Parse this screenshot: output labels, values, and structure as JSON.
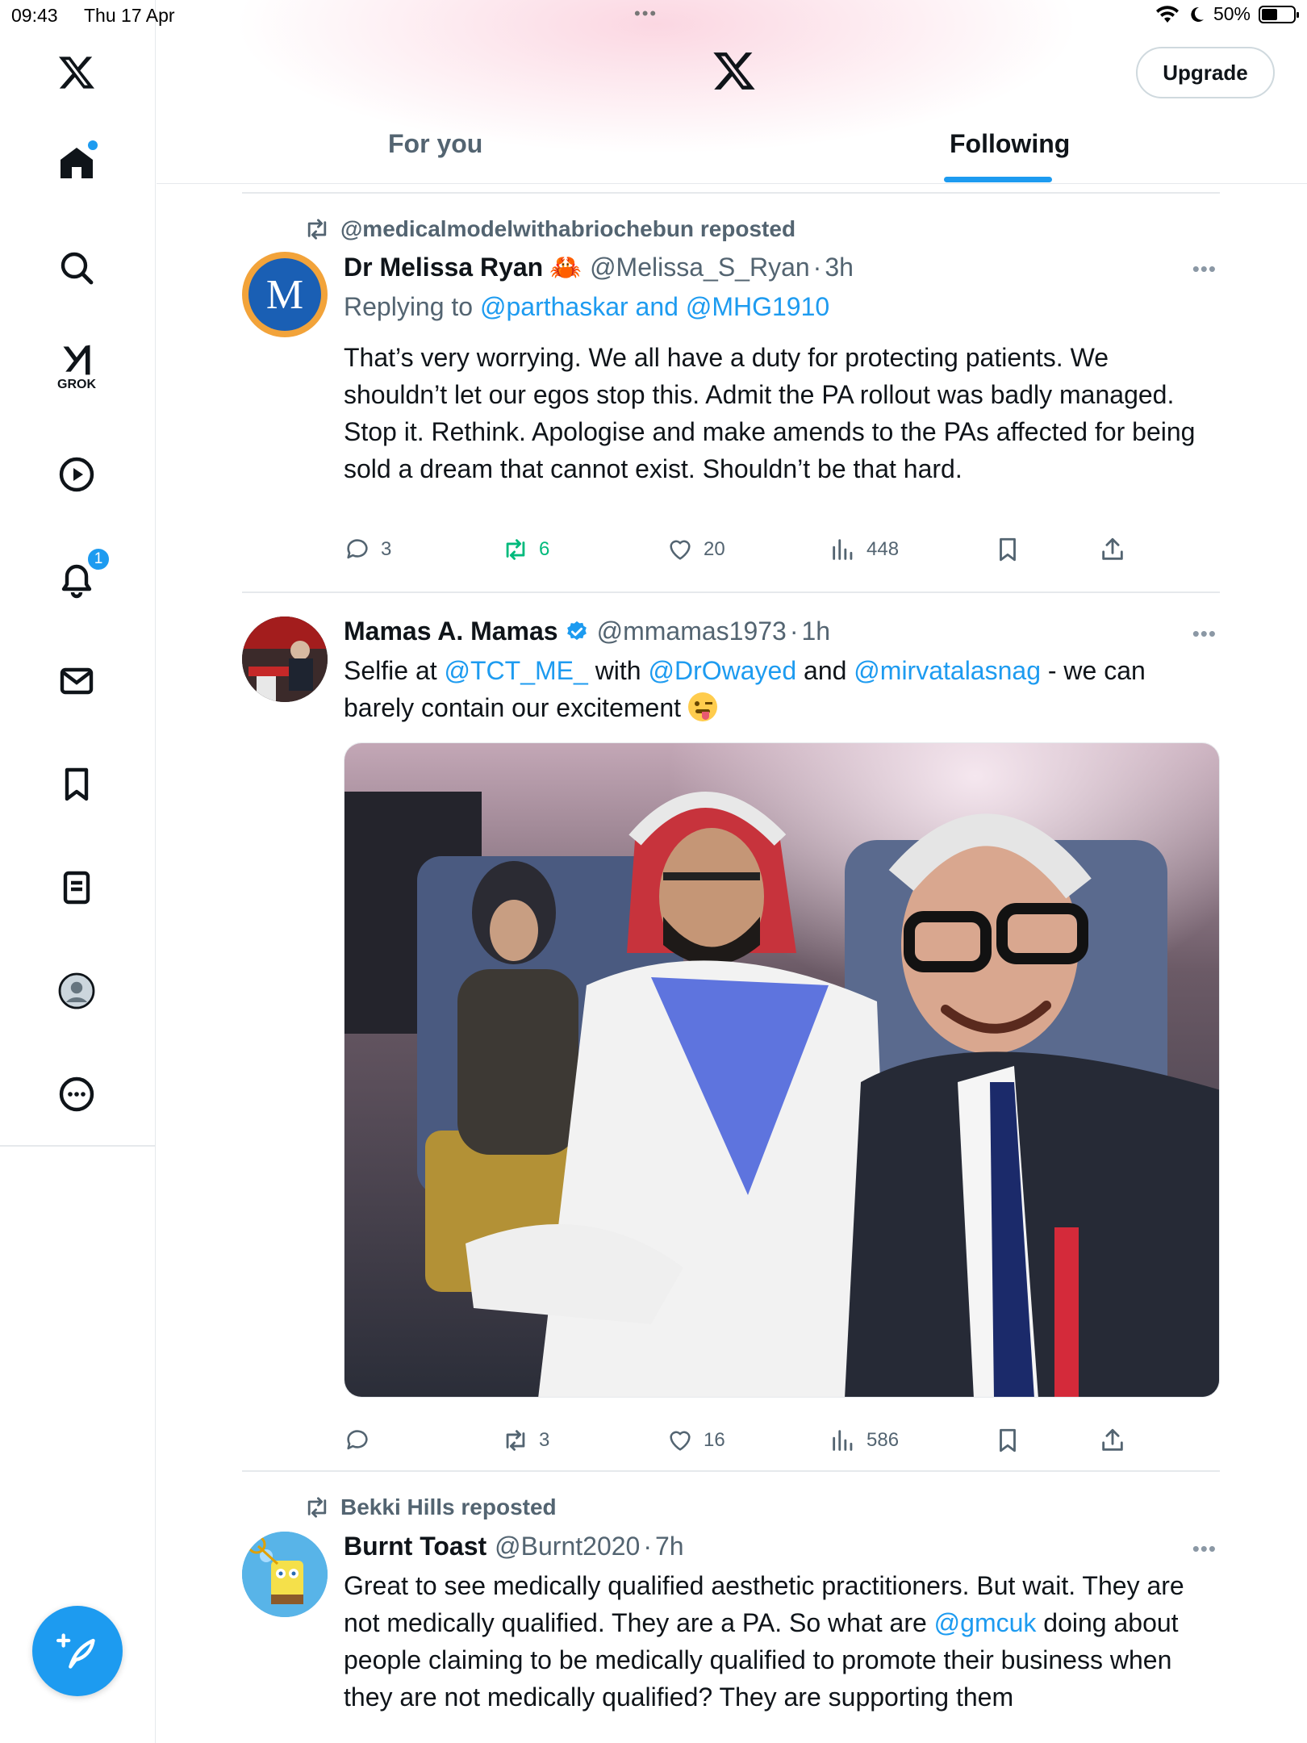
{
  "status_bar": {
    "time": "09:43",
    "date": "Thu 17 Apr",
    "battery_pct": "50%",
    "battery_level": 0.5
  },
  "sidebar": {
    "items": [
      {
        "name": "home",
        "icon": "home-icon"
      },
      {
        "name": "search",
        "icon": "search-icon"
      },
      {
        "name": "grok",
        "icon": "grok-icon",
        "label": "GROK"
      },
      {
        "name": "video",
        "icon": "play-icon"
      },
      {
        "name": "notifications",
        "icon": "bell-icon",
        "badge": "1"
      },
      {
        "name": "messages",
        "icon": "envelope-icon"
      },
      {
        "name": "bookmarks",
        "icon": "bookmark-icon"
      },
      {
        "name": "lists",
        "icon": "list-icon"
      },
      {
        "name": "profile",
        "icon": "avatar-icon"
      },
      {
        "name": "more",
        "icon": "more-circle-icon"
      }
    ],
    "compose_icon": "compose-icon"
  },
  "header": {
    "upgrade_label": "Upgrade",
    "tabs": [
      {
        "label": "For you",
        "active": false
      },
      {
        "label": "Following",
        "active": true
      }
    ]
  },
  "colors": {
    "accent": "#1d9bf0",
    "repost_green": "#00ba7c",
    "secondary_text": "#536471"
  },
  "posts": [
    {
      "repost_by": "@medicalmodelwithabriochebun reposted",
      "name": "Dr Melissa Ryan",
      "name_emoji": "🦀",
      "handle": "@Melissa_S_Ryan",
      "time": "3h",
      "reply_prefix": "Replying to ",
      "reply_to": "@parthaskar and @MHG1910",
      "text": "That’s very worrying. We all have a duty for protecting patients. We shouldn’t let our egos stop this. Admit the PA rollout was badly managed. Stop it. Rethink. Apologise and make amends to the PAs affected for being sold a dream that cannot exist. Shouldn’t be that hard.",
      "avatar_letter": "M",
      "stats": {
        "replies": "3",
        "reposts": "6",
        "likes": "20",
        "views": "448"
      }
    },
    {
      "name": "Mamas A. Mamas",
      "verified": true,
      "handle": "@mmamas1973",
      "time": "1h",
      "text_parts": [
        "Selfie at ",
        "@TCT_ME_",
        " with ",
        "@DrOwayed",
        " and ",
        "@mirvatalasnag",
        " - we can barely contain our excitement "
      ],
      "stats": {
        "replies": "",
        "reposts": "3",
        "likes": "16",
        "views": "586"
      }
    },
    {
      "repost_by": "Bekki Hills reposted",
      "name": "Burnt Toast",
      "handle": "@Burnt2020",
      "time": "7h",
      "text_parts": [
        "Great to see medically qualified aesthetic practitioners. But wait. They are not medically qualified. They are a PA. So what are ",
        "@gmcuk",
        " doing about people claiming to be medically qualified to promote their business when they are not medically qualified? They are supporting them"
      ]
    }
  ]
}
